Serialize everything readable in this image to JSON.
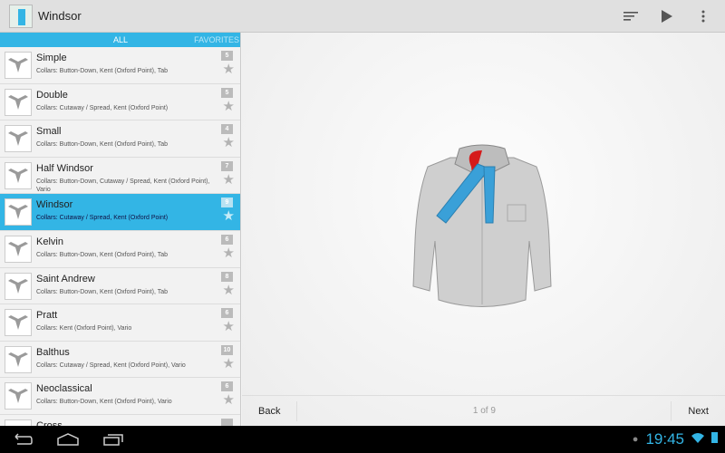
{
  "app": {
    "title": "Windsor",
    "actions": [
      "sort-icon",
      "play-icon",
      "overflow-menu-icon"
    ]
  },
  "tabs": {
    "all": "ALL",
    "favorites": "FAVORITES"
  },
  "knots": [
    {
      "name": "Simple",
      "collars": "Collars: Button-Down, Kent (Oxford Point), Tab",
      "level": "5"
    },
    {
      "name": "Double",
      "collars": "Collars: Cutaway / Spread, Kent (Oxford Point)",
      "level": "5"
    },
    {
      "name": "Small",
      "collars": "Collars: Button-Down, Kent (Oxford Point), Tab",
      "level": "4"
    },
    {
      "name": "Half Windsor",
      "collars": "Collars: Button-Down, Cutaway / Spread, Kent (Oxford Point), Vario",
      "level": "7"
    },
    {
      "name": "Windsor",
      "collars": "Collars: Cutaway / Spread, Kent (Oxford Point)",
      "level": "9",
      "selected": true
    },
    {
      "name": "Kelvin",
      "collars": "Collars: Button-Down, Kent (Oxford Point), Tab",
      "level": "6"
    },
    {
      "name": "Saint Andrew",
      "collars": "Collars: Button-Down, Kent (Oxford Point), Tab",
      "level": "8"
    },
    {
      "name": "Pratt",
      "collars": "Collars: Kent (Oxford Point), Vario",
      "level": "6"
    },
    {
      "name": "Balthus",
      "collars": "Collars: Cutaway / Spread, Kent (Oxford Point), Vario",
      "level": "10"
    },
    {
      "name": "Neoclassical",
      "collars": "Collars: Button-Down, Kent (Oxford Point), Vario",
      "level": "6"
    },
    {
      "name": "Cross",
      "collars": "",
      "level": ""
    }
  ],
  "footer": {
    "back": "Back",
    "page": "1 of 9",
    "next": "Next"
  },
  "status": {
    "clock": "19:45"
  },
  "colors": {
    "accent": "#33b5e5"
  }
}
